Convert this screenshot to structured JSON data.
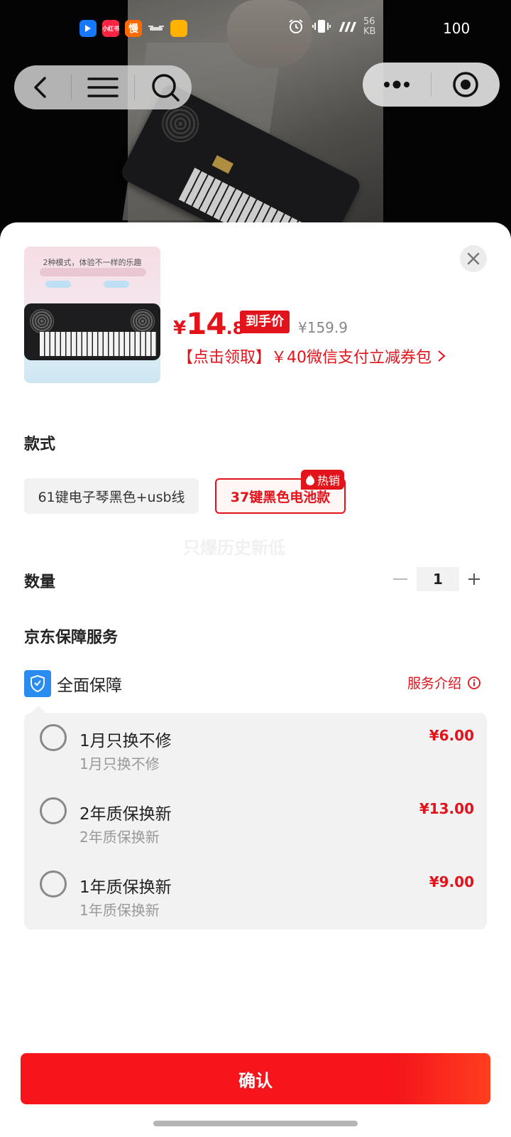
{
  "status_bar": {
    "apps": [
      {
        "name": "app-blue",
        "label": "",
        "color": "#1677ff"
      },
      {
        "name": "app-xiaohongshu",
        "label": "小红书",
        "color": "#ff2442"
      },
      {
        "name": "app-orange",
        "label": "慢",
        "color": "#ff6a00"
      },
      {
        "name": "app-drone",
        "label": "",
        "color": "#333333"
      },
      {
        "name": "app-yellow",
        "label": "",
        "color": "#ffb300"
      }
    ],
    "net_speed": "56",
    "net_unit": "KB",
    "battery": "100"
  },
  "product": {
    "price_symbol": "¥",
    "price_integer": "14",
    "price_decimal": ".8",
    "price_tag": "到手价",
    "original_price": "¥159.9",
    "coupon_text": "【点击领取】￥40微信支付立减券包",
    "thumb_caption": "2种模式，体验不一样的乐趣"
  },
  "spec": {
    "title": "款式",
    "options": [
      {
        "label": "61键电子琴黑色+usb线",
        "selected": false
      },
      {
        "label": "37键黑色电池款",
        "selected": true
      }
    ],
    "hot_badge": "热销",
    "watermark": "只爆历史新低"
  },
  "quantity": {
    "title": "数量",
    "value": "1",
    "minus": "−",
    "plus": "+"
  },
  "guarantee": {
    "title": "京东保障服务",
    "label": "全面保障",
    "intro": "服务介绍",
    "items": [
      {
        "name": "1月只换不修",
        "desc": "1月只换不修",
        "price": "¥6.00"
      },
      {
        "name": "2年质保换新",
        "desc": "2年质保换新",
        "price": "¥13.00"
      },
      {
        "name": "1年质保换新",
        "desc": "1年质保换新",
        "price": "¥9.00"
      }
    ]
  },
  "confirm_label": "确认",
  "colors": {
    "accent": "#e3131b",
    "guard_blue": "#2a8cf0"
  }
}
